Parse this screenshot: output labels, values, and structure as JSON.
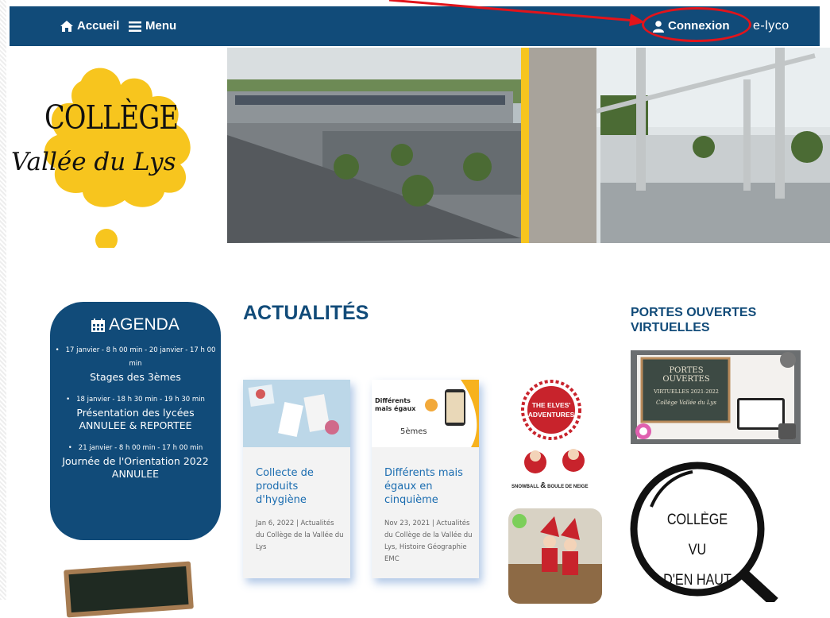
{
  "nav": {
    "home": "Accueil",
    "menu": "Menu",
    "login": "Connexion",
    "elyco": "e-lyco"
  },
  "logo": {
    "title": "COLLÈGE",
    "subtitle": "Vallée du Lys"
  },
  "agenda": {
    "title": "AGENDA",
    "events": [
      {
        "date": "17 janvier - 8 h 00 min - 20 janvier - 17 h 00 min",
        "name": "Stages des 3èmes"
      },
      {
        "date": "18 janvier - 18 h 30 min - 19 h 30 min",
        "name": "Présentation des lycées ANNULEE & REPORTEE"
      },
      {
        "date": "21 janvier - 8 h 00 min - 17 h 00 min",
        "name": "Journée de l'Orientation 2022 ANNULEE"
      }
    ]
  },
  "news": {
    "title": "ACTUALITÉS",
    "posts": [
      {
        "title": "Collecte de produits d'hygiène",
        "meta": "Jan 6, 2022 | Actualités du Collège de la Vallée du Lys"
      },
      {
        "title": "Différents mais égaux en cinquième",
        "meta": "Nov 23, 2021 | Actualités du Collège de la Vallée du Lys, Histoire Géographie EMC",
        "image_text": "Différents mais égaux",
        "image_sub": "5èmes"
      }
    ]
  },
  "elves": {
    "title_line1": "THE ELVES'",
    "title_line2": "ADVENTURES",
    "caption_left": "SNOWBALL",
    "caption_amp": "&",
    "caption_right": "BOULE DE NEIGE"
  },
  "portes": {
    "title": "PORTES OUVERTES VIRTUELLES",
    "thumb_line1": "PORTES OUVERTES",
    "thumb_line2": "VIRTUELLES 2021-2022",
    "thumb_line3": "Collège Vallée du Lys"
  },
  "magnifier": {
    "line1": "COLLÈGE VU",
    "line2": "D'EN HAUT"
  },
  "colors": {
    "brand_blue": "#114b79",
    "accent_yellow": "#f7c51e",
    "annotation_red": "#e2141b"
  }
}
